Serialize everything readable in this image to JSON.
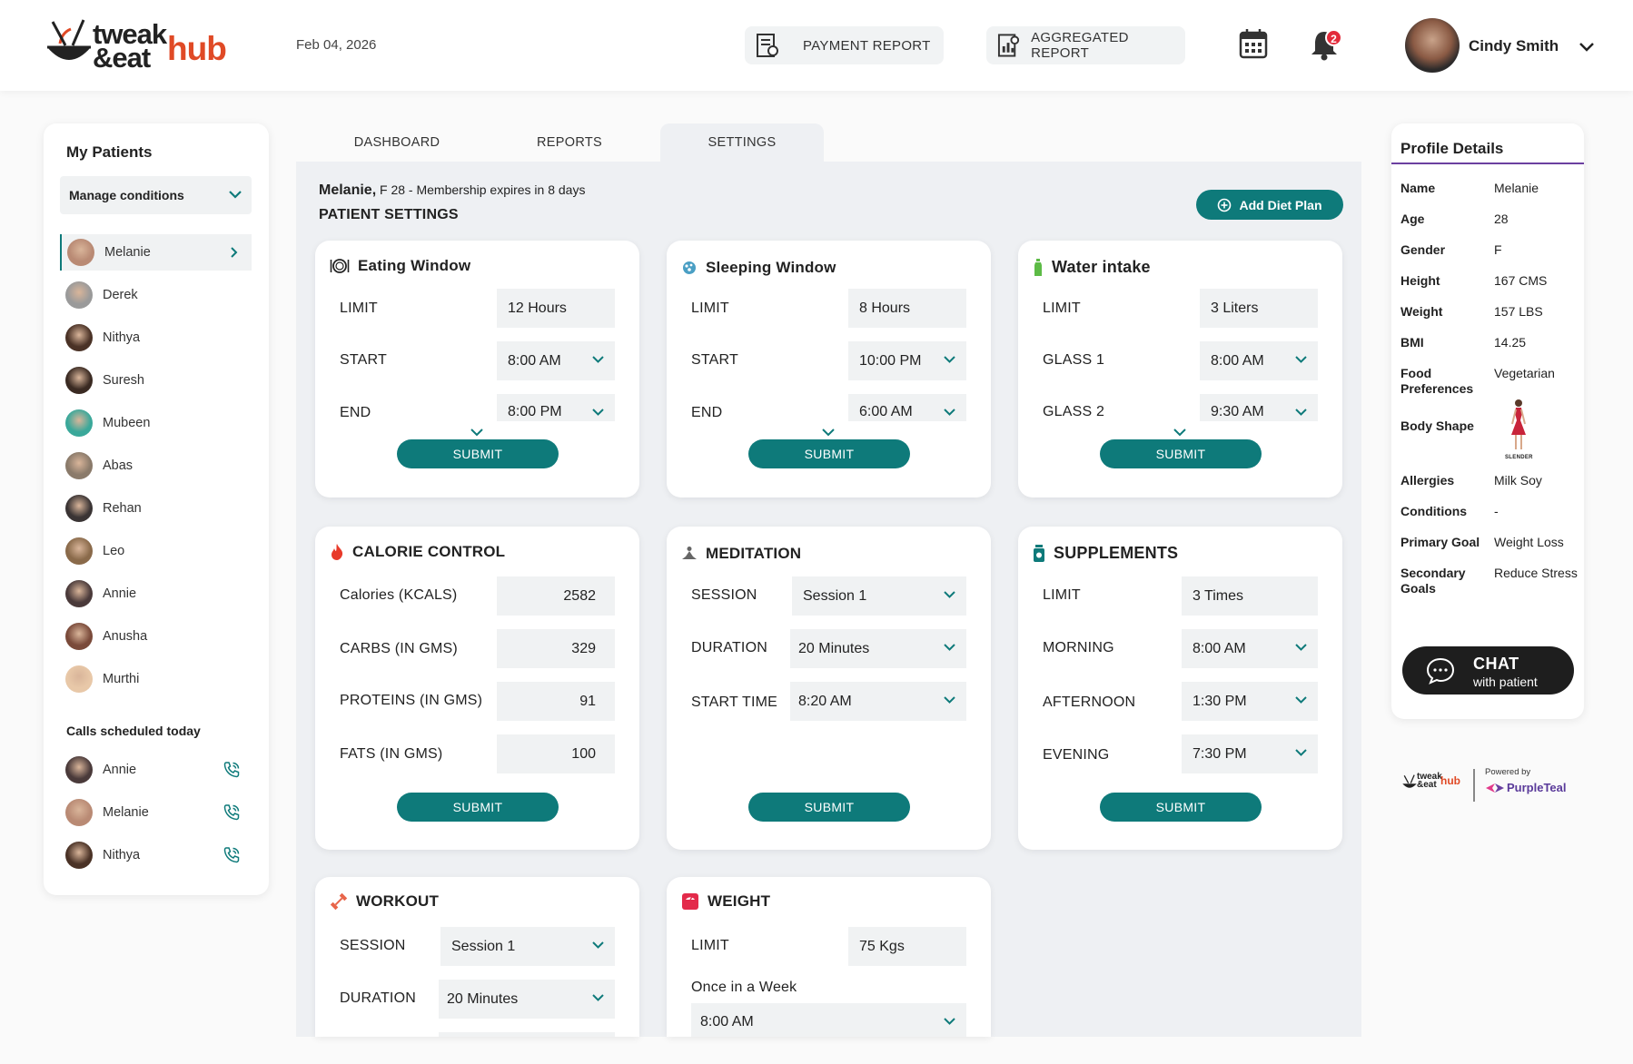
{
  "header": {
    "logo": {
      "line1": "tweak",
      "line2": "&eat",
      "accent": "hub"
    },
    "date": "Feb 04, 2026",
    "payment_report": "PAYMENT REPORT",
    "aggregated_report": "AGGREGATED REPORT",
    "notification_count": "2",
    "user_name": "Cindy Smith"
  },
  "sidebar": {
    "title": "My Patients",
    "filter": "Manage conditions",
    "patients": [
      "Melanie",
      "Derek",
      "Nithya",
      "Suresh",
      "Mubeen",
      "Abas",
      "Rehan",
      "Leo",
      "Annie",
      "Anusha",
      "Murthi"
    ],
    "calls_title": "Calls scheduled today",
    "calls": [
      "Annie",
      "Melanie",
      "Nithya"
    ]
  },
  "tabs": [
    "DASHBOARD",
    "REPORTS",
    "SETTINGS"
  ],
  "patient": {
    "name": "Melanie,",
    "info": " F 28 - Membership expires in 8 days",
    "section_title": "PATIENT SETTINGS",
    "add_diet_plan": "Add Diet Plan"
  },
  "submit_label": "SUBMIT",
  "widgets": {
    "eating": {
      "title": "Eating Window",
      "limit_label": "LIMIT",
      "limit": "12 Hours",
      "start_label": "START",
      "start": "8:00 AM",
      "end_label": "END",
      "end": "8:00 PM"
    },
    "sleeping": {
      "title": "Sleeping Window",
      "limit_label": "LIMIT",
      "limit": "8 Hours",
      "start_label": "START",
      "start": "10:00 PM",
      "end_label": "END",
      "end": "6:00 AM"
    },
    "water": {
      "title": "Water intake",
      "limit_label": "LIMIT",
      "limit": "3 Liters",
      "g1_label": "GLASS 1",
      "g1": "8:00 AM",
      "g2_label": "GLASS 2",
      "g2": "9:30 AM"
    },
    "calorie": {
      "title": "CALORIE CONTROL",
      "cal_label": "Calories (KCALS)",
      "cal": "2582",
      "carbs_label": "CARBS (IN GMS)",
      "carbs": "329",
      "prot_label": "PROTEINS (IN GMS)",
      "prot": "91",
      "fats_label": "FATS (IN GMS)",
      "fats": "100"
    },
    "meditation": {
      "title": "MEDITATION",
      "session_label": "SESSION",
      "session": "Session 1",
      "duration_label": "DURATION",
      "duration": "20 Minutes",
      "start_label": "START TIME",
      "start": "8:20 AM"
    },
    "supplements": {
      "title": "SUPPLEMENTS",
      "limit_label": "LIMIT",
      "limit": "3 Times",
      "morning_label": "MORNING",
      "morning": "8:00 AM",
      "afternoon_label": "AFTERNOON",
      "afternoon": "1:30 PM",
      "evening_label": "EVENING",
      "evening": "7:30 PM"
    },
    "workout": {
      "title": "WORKOUT",
      "session_label": "SESSION",
      "session": "Session 1",
      "duration_label": "DURATION",
      "duration": "20 Minutes"
    },
    "weight": {
      "title": "WEIGHT",
      "limit_label": "LIMIT",
      "limit": "75 Kgs",
      "freq": "Once in a Week",
      "time": "8:00 AM"
    }
  },
  "profile": {
    "title": "Profile Details",
    "rows": [
      {
        "k": "Name",
        "v": "Melanie"
      },
      {
        "k": "Age",
        "v": "28"
      },
      {
        "k": "Gender",
        "v": "F"
      },
      {
        "k": "Height",
        "v": "167 CMS"
      },
      {
        "k": "Weight",
        "v": "157 LBS"
      },
      {
        "k": "BMI",
        "v": "14.25"
      },
      {
        "k": "Food Preferences",
        "v": "Vegetarian"
      },
      {
        "k": "Body Shape",
        "v": ""
      },
      {
        "k": "Allergies",
        "v": "Milk Soy"
      },
      {
        "k": "Conditions",
        "v": "-"
      },
      {
        "k": "Primary Goal",
        "v": "Weight Loss"
      },
      {
        "k": "Secondary Goals",
        "v": "Reduce Stress"
      }
    ],
    "body_shape_caption": "SLENDER",
    "chat_title": "CHAT",
    "chat_sub": "with patient"
  },
  "footer": {
    "logo_line1": "tweak",
    "logo_line2": "&eat",
    "logo_accent": "hub",
    "powered_by": "Powered by",
    "brand": "PurpleTeal"
  },
  "colors": {
    "accent": "#0e7a7a",
    "logo_accent": "#e04a26",
    "badge": "#e32a3a",
    "profile_line": "#6b3fa0"
  }
}
